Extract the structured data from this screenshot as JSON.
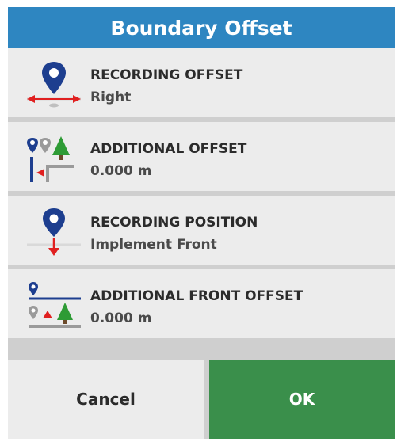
{
  "dialog": {
    "title": "Boundary Offset",
    "rows": [
      {
        "label": "RECORDING OFFSET",
        "value": "Right",
        "icon": "recording-offset-icon"
      },
      {
        "label": "ADDITIONAL OFFSET",
        "value": "0.000 m",
        "icon": "additional-offset-icon"
      },
      {
        "label": "RECORDING POSITION",
        "value": "Implement Front",
        "icon": "recording-position-icon"
      },
      {
        "label": "ADDITIONAL FRONT OFFSET",
        "value": "0.000 m",
        "icon": "additional-front-offset-icon"
      }
    ],
    "buttons": {
      "cancel": "Cancel",
      "ok": "OK"
    }
  },
  "colors": {
    "title_bar": "#2e86c1",
    "ok_button": "#3a8f4b",
    "row_background": "#ececec",
    "marker_blue": "#1d3e8f",
    "arrow_red": "#e02020",
    "tree_green": "#2e9b35"
  }
}
